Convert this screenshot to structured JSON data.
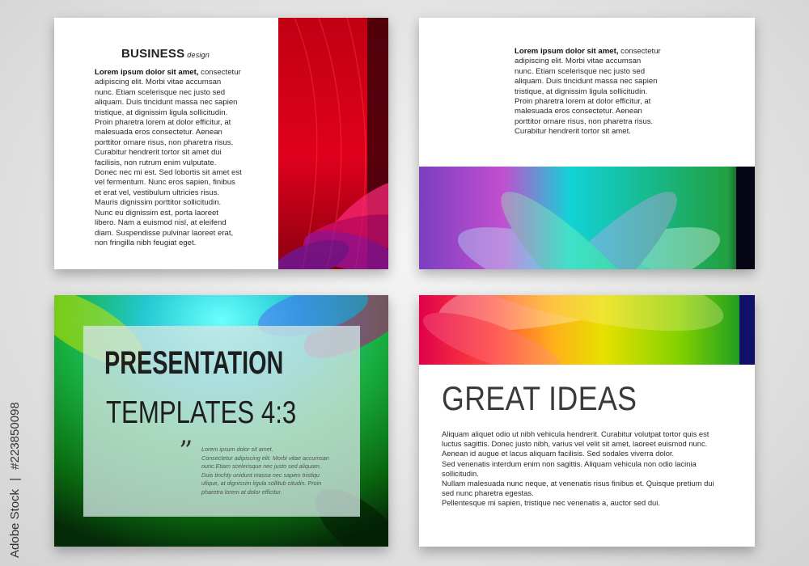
{
  "colors": {
    "background": "#e2e2e2",
    "slide_bg": "#ffffff",
    "text": "#2a2a2a",
    "red_art": [
      "#2b0008",
      "#8a0010",
      "#e1001a",
      "#ff2a5a",
      "#c0107a",
      "#7a1aa8"
    ],
    "rainbow_art": [
      "#7a3fc0",
      "#c24fd0",
      "#12d3d6",
      "#18b889",
      "#20a040",
      "#050515"
    ],
    "green_art": [
      "#0a6a10",
      "#22c022",
      "#c8e600",
      "#1ad9e0",
      "#4a6cf0",
      "#c0107a"
    ],
    "warm_art": [
      "#e0004a",
      "#ff6a1a",
      "#f2e000",
      "#b8e000",
      "#22a020",
      "#10106a"
    ]
  },
  "slide1": {
    "title": "BUSINESS",
    "title_suffix": "design",
    "lead": "Lorem ipsum dolor sit amet,",
    "lines": [
      "consectetur",
      "adipiscing elit. Morbi vitae accumsan",
      "nunc. Etiam scelerisque nec justo sed",
      "aliquam. Duis tincidunt massa nec sapien",
      "tristique, at dignissim ligula sollicitudin.",
      "Proin pharetra lorem at dolor efficitur, at",
      "malesuada eros consectetur. Aenean",
      "porttitor ornare risus, non pharetra risus.",
      "Curabitur hendrerit tortor sit amet dui",
      "facilisis, non rutrum enim vulputate.",
      "Donec nec mi est. Sed lobortis sit amet est",
      "vel fermentum. Nunc eros sapien, finibus",
      "et erat vel, vestibulum ultricies risus.",
      "Mauris dignissim porttitor sollicitudin.",
      "Nunc eu dignissim est, porta laoreet",
      "libero. Nam a euismod nisl, at eleifend",
      "diam. Suspendisse pulvinar laoreet erat,",
      "non fringilla nibh feugiat eget."
    ]
  },
  "slide2": {
    "lead": "Lorem ipsum dolor sit amet,",
    "lines": [
      "consectetur",
      "adipiscing elit. Morbi vitae accumsan",
      "nunc. Etiam scelerisque nec justo sed",
      "aliquam. Duis tincidunt massa nec sapien",
      "tristique, at dignissim ligula sollicitudin.",
      "Proin pharetra lorem at dolor efficitur, at",
      "malesuada eros consectetur. Aenean",
      "porttitor ornare risus, non pharetra risus.",
      "Curabitur hendrerit tortor sit amet."
    ]
  },
  "slide3": {
    "title_line1": "PRESENTATION",
    "title_line2": "TEMPLATES   4:3",
    "quote_mark": "”",
    "quote_lines": [
      "Lorem ipsum dolor sit amet.",
      "Consectetur adipiscing elit. Morbi vitae accumsan",
      "nunc.Etiam scelerisque nec justo sed aliquam.",
      "Duis tinchty unidunt massa nec sapien tristiqu",
      "ufique, at dignissim ligula sollitub citudin. Proin",
      "pharetra lorem at dolor efficitur."
    ]
  },
  "slide4": {
    "title": "GREAT IDEAS",
    "lines": [
      "Aliquam aliquet odio ut nibh vehicula hendrerit. Curabitur volutpat tortor quis est",
      "luctus sagittis. Donec justo nibh, varius vel velit sit amet, laoreet euismod nunc.",
      "Aenean id augue et lacus aliquam facilisis. Sed sodales viverra dolor.",
      "Sed venenatis interdum enim non sagittis. Aliquam vehicula non odio lacinia",
      "sollicitudin.",
      "Nullam malesuada nunc neque, at venenatis risus finibus et. Quisque pretium dui",
      "sed nunc pharetra egestas.",
      "Pellentesque mi sapien, tristique nec venenatis a, auctor sed dui."
    ]
  },
  "credit": {
    "brand": "Adobe Stock",
    "separator": "|",
    "number": "#223850098"
  }
}
